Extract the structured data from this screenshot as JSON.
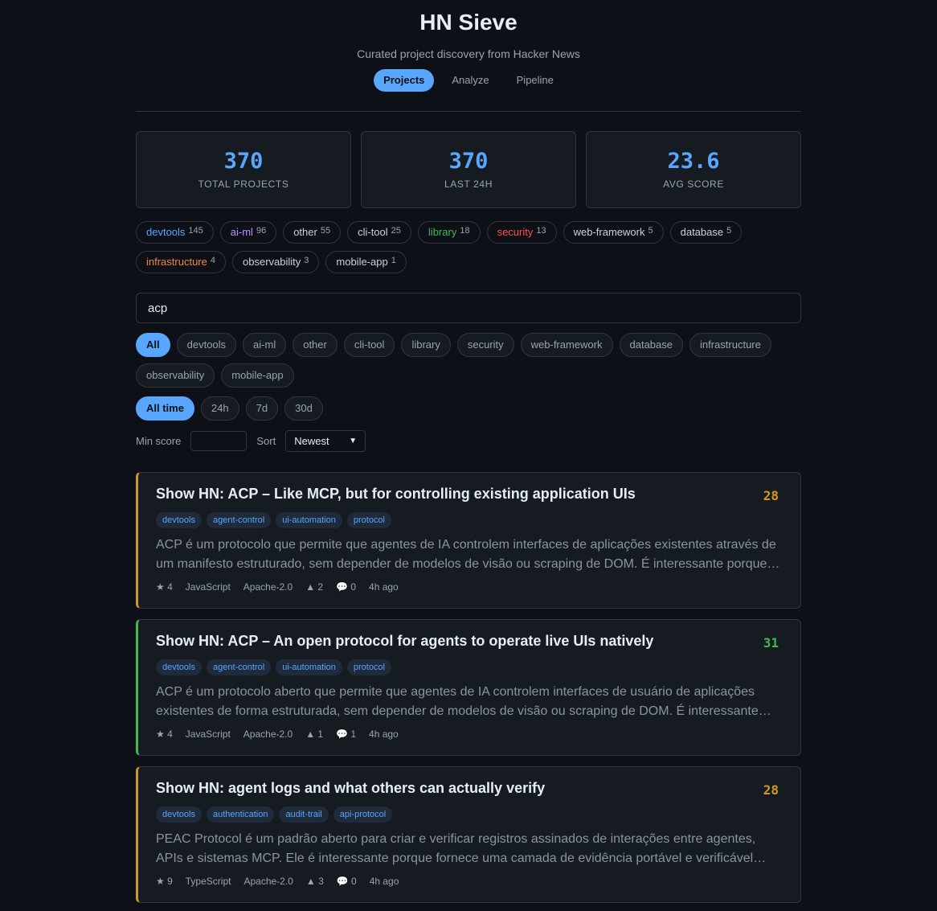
{
  "header": {
    "title": "HN Sieve",
    "subtitle": "Curated project discovery from Hacker News",
    "tabs": [
      "Projects",
      "Analyze",
      "Pipeline"
    ],
    "active_tab": "Projects"
  },
  "stats": [
    {
      "value": "370",
      "label": "TOTAL PROJECTS"
    },
    {
      "value": "370",
      "label": "LAST 24H"
    },
    {
      "value": "23.6",
      "label": "AVG SCORE"
    }
  ],
  "category_counts": [
    {
      "name": "devtools",
      "count": "145",
      "color": "#58a6ff"
    },
    {
      "name": "ai-ml",
      "count": "96",
      "color": "#bc8cff"
    },
    {
      "name": "other",
      "count": "55",
      "color": "#c9d1d9"
    },
    {
      "name": "cli-tool",
      "count": "25",
      "color": "#c9d1d9"
    },
    {
      "name": "library",
      "count": "18",
      "color": "#3fb950"
    },
    {
      "name": "security",
      "count": "13",
      "color": "#f85149"
    },
    {
      "name": "web-framework",
      "count": "5",
      "color": "#c9d1d9"
    },
    {
      "name": "database",
      "count": "5",
      "color": "#c9d1d9"
    },
    {
      "name": "infrastructure",
      "count": "4",
      "color": "#f0883e"
    },
    {
      "name": "observability",
      "count": "3",
      "color": "#c9d1d9"
    },
    {
      "name": "mobile-app",
      "count": "1",
      "color": "#c9d1d9"
    }
  ],
  "search": {
    "value": "acp"
  },
  "category_filters": [
    "All",
    "devtools",
    "ai-ml",
    "other",
    "cli-tool",
    "library",
    "security",
    "web-framework",
    "database",
    "infrastructure",
    "observability",
    "mobile-app"
  ],
  "time_filters": [
    "All time",
    "24h",
    "7d",
    "30d"
  ],
  "controls": {
    "min_score_label": "Min score",
    "min_score_value": "",
    "sort_label": "Sort",
    "sort_value": "Newest"
  },
  "projects": [
    {
      "title": "Show HN: ACP – Like MCP, but for controlling existing application UIs",
      "score": "28",
      "tags": [
        "devtools",
        "agent-control",
        "ui-automation",
        "protocol"
      ],
      "description": "ACP é um protocolo que permite que agentes de IA controlem interfaces de aplicações existentes através de um manifesto estruturado, sem depender de modelos de visão ou scraping de DOM. É interessante porque…",
      "stars": "★ 4",
      "language": "JavaScript",
      "license": "Apache-2.0",
      "points": "▲ 2",
      "comments": "💬 0",
      "age": "4h ago",
      "accent": "#d29922"
    },
    {
      "title": "Show HN: ACP – An open protocol for agents to operate live UIs natively",
      "score": "31",
      "tags": [
        "devtools",
        "agent-control",
        "ui-automation",
        "protocol"
      ],
      "description": "ACP é um protocolo aberto que permite que agentes de IA controlem interfaces de usuário de aplicações existentes de forma estruturada, sem depender de modelos de visão ou scraping de DOM. É interessante…",
      "stars": "★ 4",
      "language": "JavaScript",
      "license": "Apache-2.0",
      "points": "▲ 1",
      "comments": "💬 1",
      "age": "4h ago",
      "accent": "#3fb950"
    },
    {
      "title": "Show HN: agent logs and what others can actually verify",
      "score": "28",
      "tags": [
        "devtools",
        "authentication",
        "audit-trail",
        "api-protocol"
      ],
      "description": "PEAC Protocol é um padrão aberto para criar e verificar registros assinados de interações entre agentes, APIs e sistemas MCP. Ele é interessante porque fornece uma camada de evidência portável e verificável offline,…",
      "stars": "★ 9",
      "language": "TypeScript",
      "license": "Apache-2.0",
      "points": "▲ 3",
      "comments": "💬 0",
      "age": "4h ago",
      "accent": "#d29922"
    }
  ]
}
